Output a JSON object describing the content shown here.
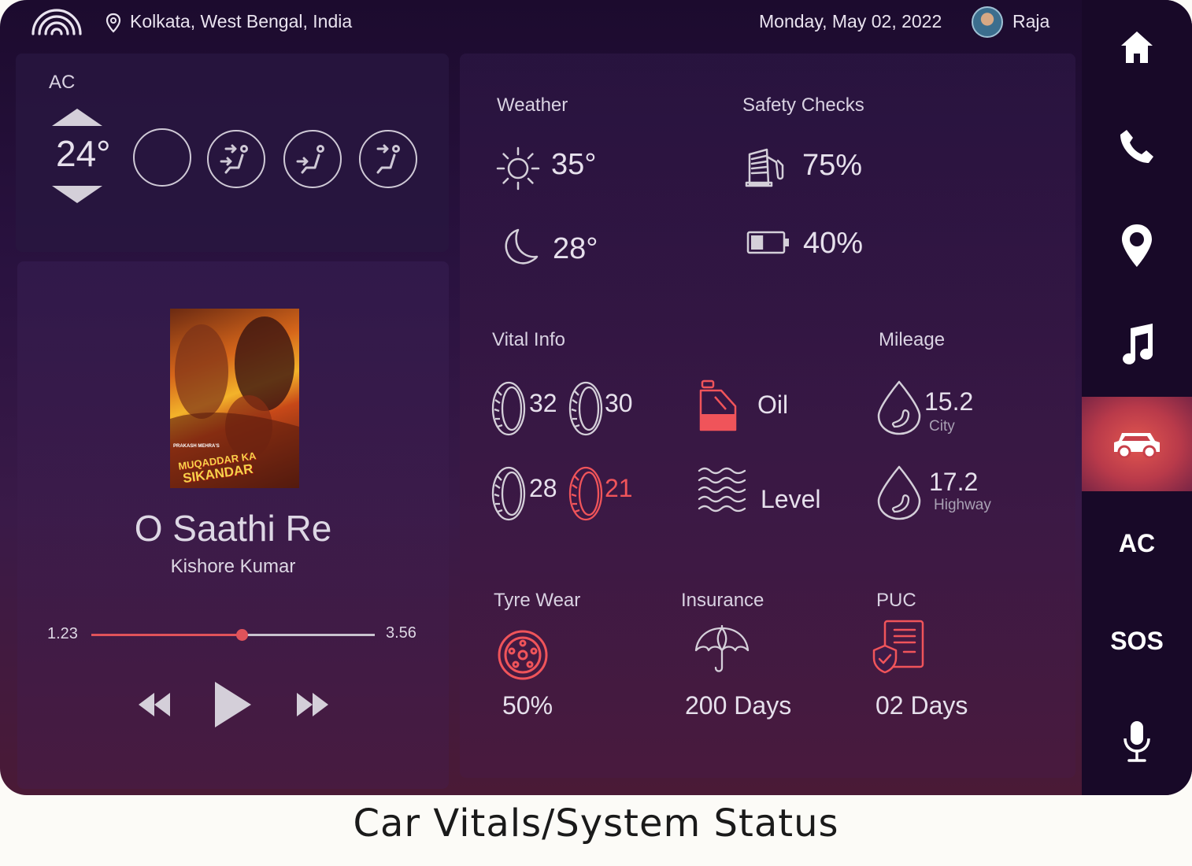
{
  "topbar": {
    "location": "Kolkata, West Bengal, India",
    "date": "Monday, May 02, 2022",
    "user_name": "Raja"
  },
  "ac": {
    "title": "AC",
    "temperature": "24°"
  },
  "music": {
    "song_title": "O Saathi Re",
    "artist": "Kishore Kumar",
    "elapsed": "1.23",
    "duration": "3.56",
    "progress": 0.53,
    "album_text_top": "PRAKASH MEHRA'S",
    "album_text_main1": "MUQADDAR KA",
    "album_text_main2": "SIKANDAR"
  },
  "weather": {
    "title": "Weather",
    "day_temp": "35°",
    "night_temp": "28°"
  },
  "safety": {
    "title": "Safety Checks",
    "fuel": "75%",
    "battery": "40%"
  },
  "vital": {
    "title": "Vital Info",
    "tyre_fl": "32",
    "tyre_fr": "30",
    "tyre_rl": "28",
    "tyre_rr": "21",
    "oil_label": "Oil",
    "level_label": "Level"
  },
  "mileage": {
    "title": "Mileage",
    "city_value": "15.2",
    "city_label": "City",
    "highway_value": "17.2",
    "highway_label": "Highway"
  },
  "tyre_wear": {
    "title": "Tyre Wear",
    "value": "50%"
  },
  "insurance": {
    "title": "Insurance",
    "value": "200 Days"
  },
  "puc": {
    "title": "PUC",
    "value": "02 Days"
  },
  "sidebar": {
    "items": [
      {
        "icon": "home-icon"
      },
      {
        "icon": "phone-icon"
      },
      {
        "icon": "map-pin-icon"
      },
      {
        "icon": "music-note-icon"
      },
      {
        "icon": "car-icon",
        "active": true
      },
      {
        "label": "AC"
      },
      {
        "label": "SOS"
      },
      {
        "icon": "microphone-icon"
      }
    ]
  },
  "colors": {
    "alert": "#f0545a",
    "accent_active": "#e2564f",
    "text": "#e6e0ec"
  },
  "caption": "Car Vitals/System Status"
}
